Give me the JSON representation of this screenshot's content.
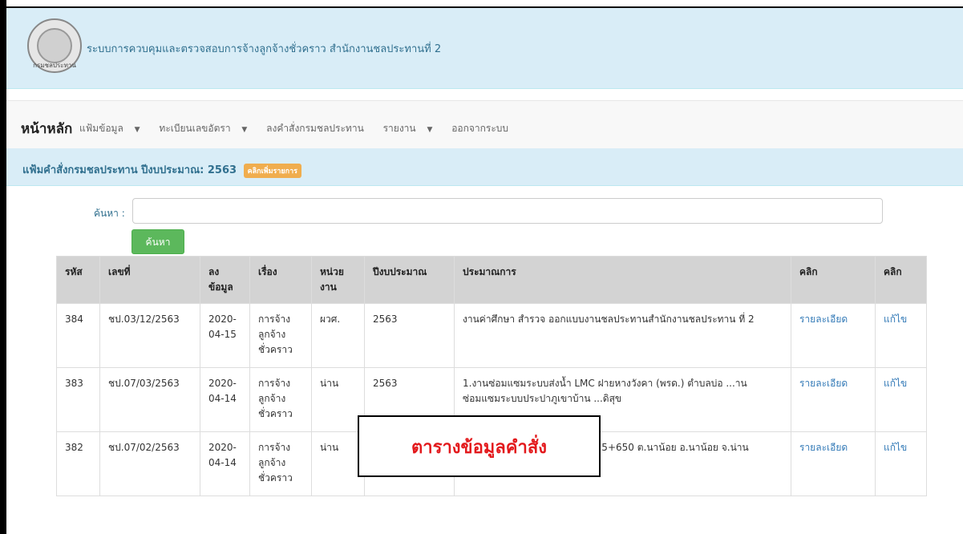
{
  "header": {
    "title": "ระบบการควบคุมและตรวจสอบการจ้างลูกจ้างชั่วคราว สำนักงานชลประทานที่ 2",
    "logo_text": "กรมชลประทาน"
  },
  "navbar": {
    "brand": "หน้าหลัก",
    "items": [
      {
        "label": "แฟ้มข้อมูล",
        "dropdown": true
      },
      {
        "label": "ทะเบียนเลขอัตรา",
        "dropdown": true
      },
      {
        "label": "ลงคำสั่งกรมชลประทาน",
        "dropdown": false
      },
      {
        "label": "รายงาน",
        "dropdown": true
      },
      {
        "label": "ออกจากระบบ",
        "dropdown": false
      }
    ]
  },
  "panel": {
    "title": "แฟ้มคำสั่งกรมชลประทาน ปีงบประมาณ: 2563",
    "badge": "คลิกเพิ่มรายการ"
  },
  "search": {
    "label": "ค้นหา :",
    "value": "",
    "button": "ค้นหา"
  },
  "table": {
    "headers": [
      "รหัส",
      "เลขที่",
      "ลงข้อมูล",
      "เรื่อง",
      "หน่วยงาน",
      "ปีงบประมาณ",
      "ประมาณการ",
      "คลิก",
      "คลิก"
    ],
    "rows": [
      {
        "id": "384",
        "number": "ชป.03/12/2563",
        "date": "2020-04-15",
        "subject": "การจ้างลูกจ้างชั่วคราว",
        "unit": "ผวศ.",
        "year": "2563",
        "estimate": "งานค่าศึกษา สำรวจ ออกแบบงานชลประทานสำนักงานชลประทาน ที่ 2",
        "detail": "รายละเอียด",
        "edit": "แก้ไข"
      },
      {
        "id": "383",
        "number": "ชป.07/03/2563",
        "date": "2020-04-14",
        "subject": "การจ้างลูกจ้างชั่วคราว",
        "unit": "น่าน",
        "year": "2563",
        "estimate": "1.งานซ่อมแซมระบบส่งน้ำ LMC ฝายหางวังคา (พรด.) ตำบลบ่อ ...านซ่อมแซมระบบประปาภูเขาบ้าน ...ดิสุข",
        "detail": "รายละเอียด",
        "edit": "แก้ไข"
      },
      {
        "id": "382",
        "number": "ชป.07/02/2563",
        "date": "2020-04-14",
        "subject": "การจ้างลูกจ้างชั่วคราว",
        "unit": "น่าน",
        "year": "",
        "estimate": "...ล่างเก็บน้ำน้ำแหง กม.5+500- 5+650 ต.นาน้อย อ.นาน้อย จ.น่าน",
        "detail": "รายละเอียด",
        "edit": "แก้ไข"
      }
    ]
  },
  "overlay": {
    "text": "ตารางข้อมูลคำสั่ง"
  }
}
